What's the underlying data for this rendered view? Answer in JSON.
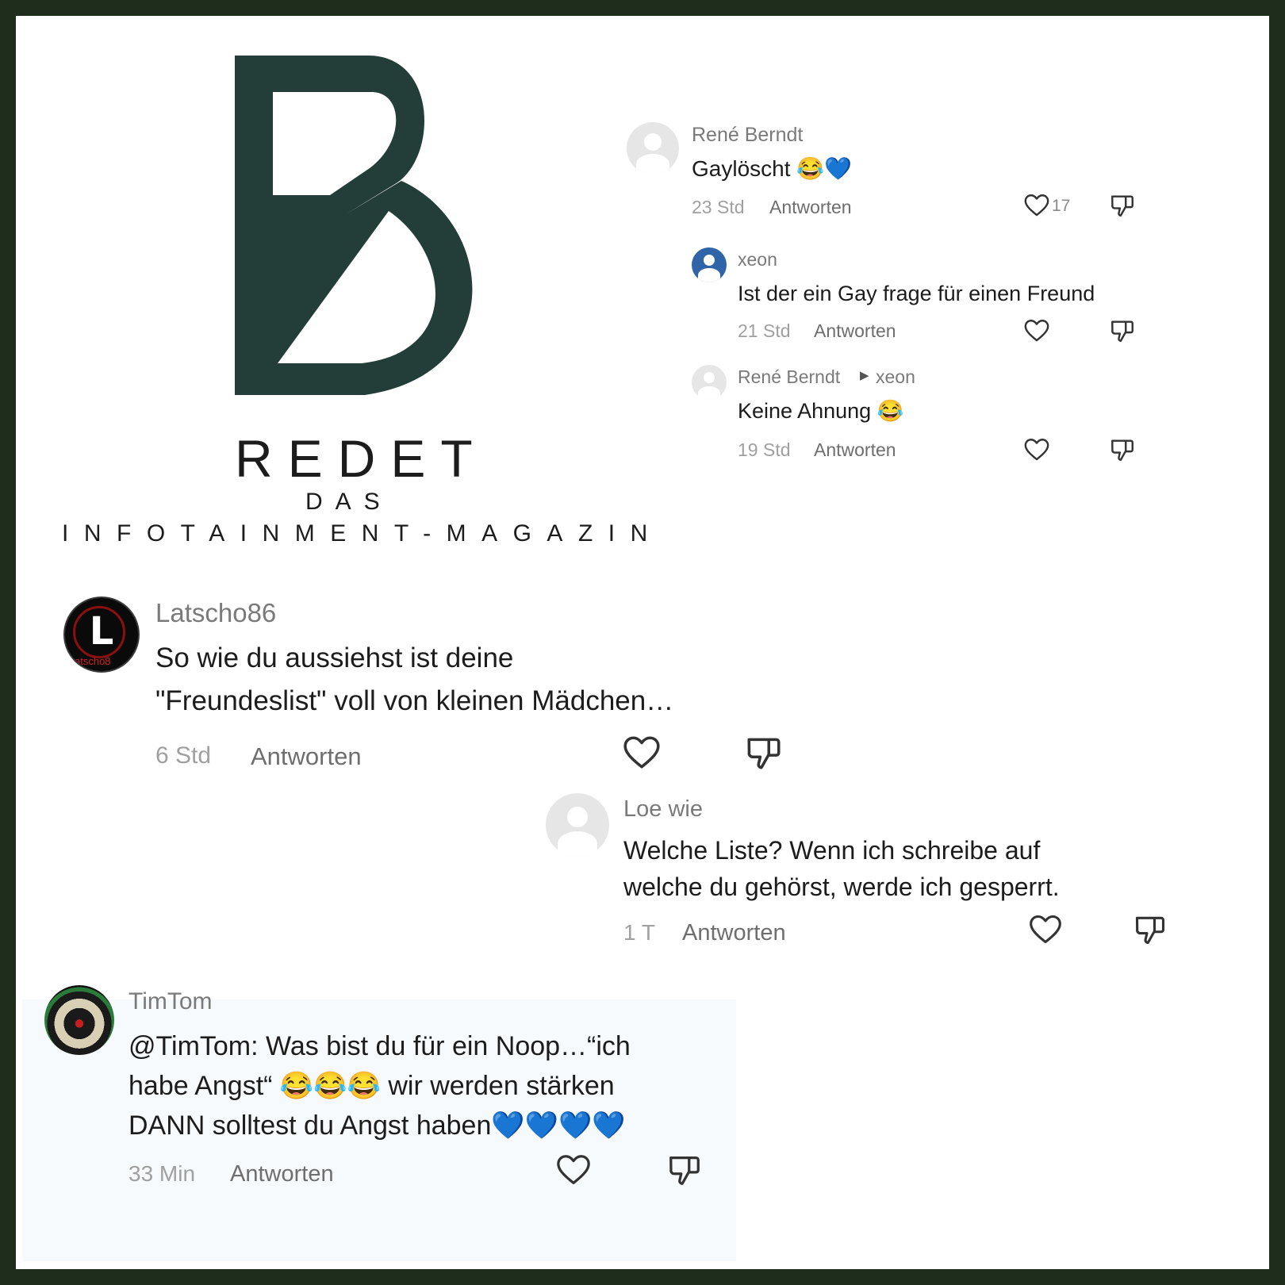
{
  "brand": {
    "word1": "REDET",
    "word2": "DAS",
    "word3": "INFOTAINMENT-MAGAZIN",
    "color": "#233d39"
  },
  "comments": [
    {
      "user": "René Berndt",
      "text": "Gaylöscht 😂💙",
      "time": "23 Std",
      "reply": "Antworten",
      "likes": "17",
      "avatar": "default-avatar"
    },
    {
      "user": "xeon",
      "text": "Ist der ein Gay frage für einen Freund",
      "time": "21 Std",
      "reply": "Antworten",
      "avatar": "blue-avatar"
    },
    {
      "user": "René Berndt",
      "reply_to": "xeon",
      "text": "Keine Ahnung 😂",
      "time": "19 Std",
      "reply": "Antworten",
      "avatar": "default-avatar"
    },
    {
      "user": "Latscho86",
      "text_line1": "So wie du aussiehst ist deine",
      "text_line2": "\"Freundeslist\" voll von kleinen Mädchen…",
      "time": "6 Std",
      "reply": "Antworten",
      "avatar": "latscho-avatar",
      "avatar_letter": "L",
      "avatar_label": "atscho8"
    },
    {
      "user": "Loe wie",
      "text_line1": "Welche Liste? Wenn ich schreibe auf",
      "text_line2": "welche du gehörst, werde ich gesperrt.",
      "time": "1 T",
      "reply": "Antworten",
      "avatar": "default-avatar"
    },
    {
      "user": "TimTom",
      "text_line1": "@TimTom: Was bist du für ein Noop…“ich",
      "text_line2": "habe Angst“ 😂😂😂 wir werden stärken",
      "text_line3": "DANN solltest du Angst haben💙💙💙💙",
      "time": "33 Min",
      "reply": "Antworten",
      "avatar": "dartboard-avatar"
    }
  ],
  "icons": {
    "like": "heart-outline-icon",
    "dislike": "thumbs-down-outline-icon",
    "reply_arrow": "caret-right-icon"
  },
  "colors": {
    "frame": "#1f2d1c",
    "text": "#1c1c1c",
    "muted": "#a0a0a0",
    "username": "#7a7a7a",
    "avatar_blue": "#2f64a8"
  }
}
